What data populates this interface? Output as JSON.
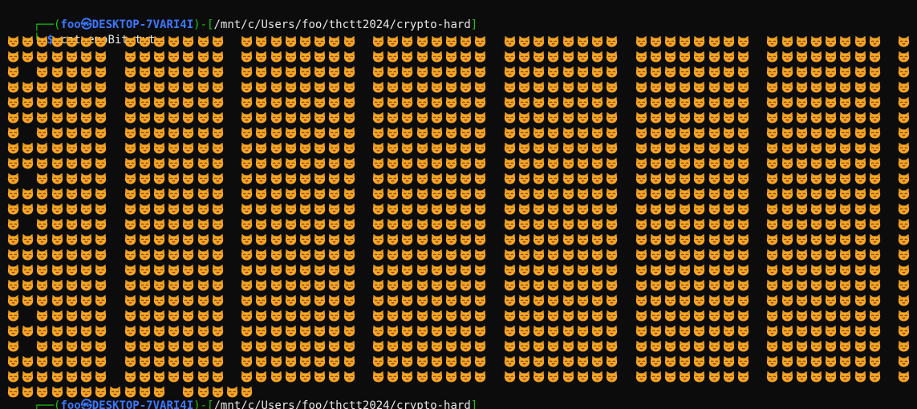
{
  "prompt": {
    "corner_top": "┌──(",
    "user": "foo",
    "at_symbol": "㉿",
    "host": "DESKTOP-7VARI4I",
    "sep": ")-[",
    "path": "/mnt/c/Users/foo/thctt2024/crypto-hard",
    "close": "]",
    "corner_bottom": "└─",
    "dollar": "$"
  },
  "command": "cat emoBit.txt",
  "output": {
    "file": "emoBit.txt",
    "icon": "cat-face-emoji",
    "emoji": "😾😼",
    "colors": {
      "face": "#f5a623",
      "face_dark": "#e08b1a",
      "feature": "#6b3a12",
      "tongue": "#e2425b"
    },
    "rows": [
      "111111101111111011111111011111111011111111011111111011111111011",
      "111111101111111011111111011111111011111111011111111011111111011",
      "101111101111111011111111011111111011111111011111111011111111011",
      "111111101111111011111111011111111011111111011111111011111111011",
      "111111101111111011111111011111111011111111011111111011111111011",
      "111111101111111011111111011111111011111111011111111011111111011",
      "101111101111111011111111011111111011111111011111111011111111011",
      "111111101111111011111111011111111011111111011111111011111111011",
      "111111101111111011111111011111111011111111011111111011111111011",
      "101111101111111011111111011111111011111111011111111011111111011",
      "111111101111111011111111011111111011111111011111111011111111011",
      "111111101111111011111111011111111011111111011111111011111111011",
      "101111101111111011111111011111111011111111011111111011111111011",
      "111111101111111011111111011111111011111111011111111011111111011",
      "111111101111111011111111011111111011111111011111111011111111011",
      "111111101111111011111111011111111011111111011111111011111111011",
      "111111101111111011111111011111111011111111011111111011111111011",
      "111111101111111011111111011111111011111111011111111011111111011",
      "101111101111111011111111011111111011111111011111111011111111011",
      "111111101111111011111111011111111011111111011111111011111111011",
      "101111101111111011111111011111111011111111011111111011111111011",
      "111111101111111011111111011111111011111111011111111011111111011",
      "111111101111111011111111011111111011111111011111111011111111011",
      "111111111110111110000000000000000000000000000000000000000000000"
    ]
  }
}
